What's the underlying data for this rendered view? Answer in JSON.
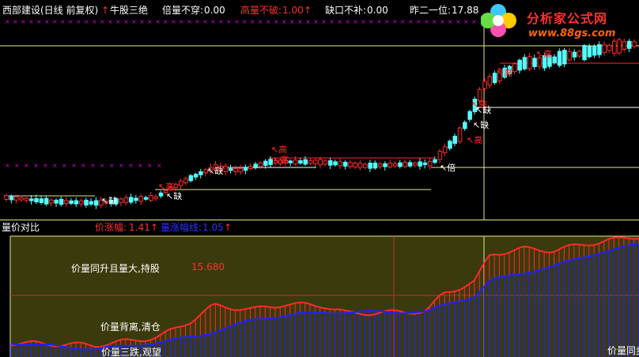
{
  "header": {
    "title": "西部建设(日线 前复权)",
    "up_arrow": "↑",
    "item1": "牛股三绝",
    "item2_label": "倍量不穿:",
    "item2_value": "0.00",
    "item3_label": "高量不破:",
    "item3_value": "1.00",
    "item3_arrow": "↑",
    "item4_label": "缺口不补:",
    "item4_value": "0.00",
    "item5_label": "昨二一位:",
    "item5_value": "17.88"
  },
  "watermark": {
    "brand": "分析家公式网",
    "url": "www.88gs.com"
  },
  "markers": {
    "high": "高",
    "gap": "缺",
    "double": "倍"
  },
  "sub": {
    "title": "量价对比",
    "l1_label": "价涨幅:",
    "l1_value": "1.41",
    "l1_arrow": "↑",
    "l2_label": "量涨幅线:",
    "l2_value": "1.05",
    "l2_arrow": "↑",
    "note_hold": "价量同升且量大,持股",
    "note_value": "15.680",
    "note_clear": "价量背离,清仓",
    "note_bottom": "价量三跌,观望",
    "note_right": "价量同步"
  },
  "colors": {
    "up": "#ff2a2a",
    "down": "#55ffff",
    "blue": "#2020ff",
    "olive": "#3c3c0c",
    "yellow": "#e8e890",
    "white": "#ffffff",
    "magenta": "#d000d0"
  }
}
